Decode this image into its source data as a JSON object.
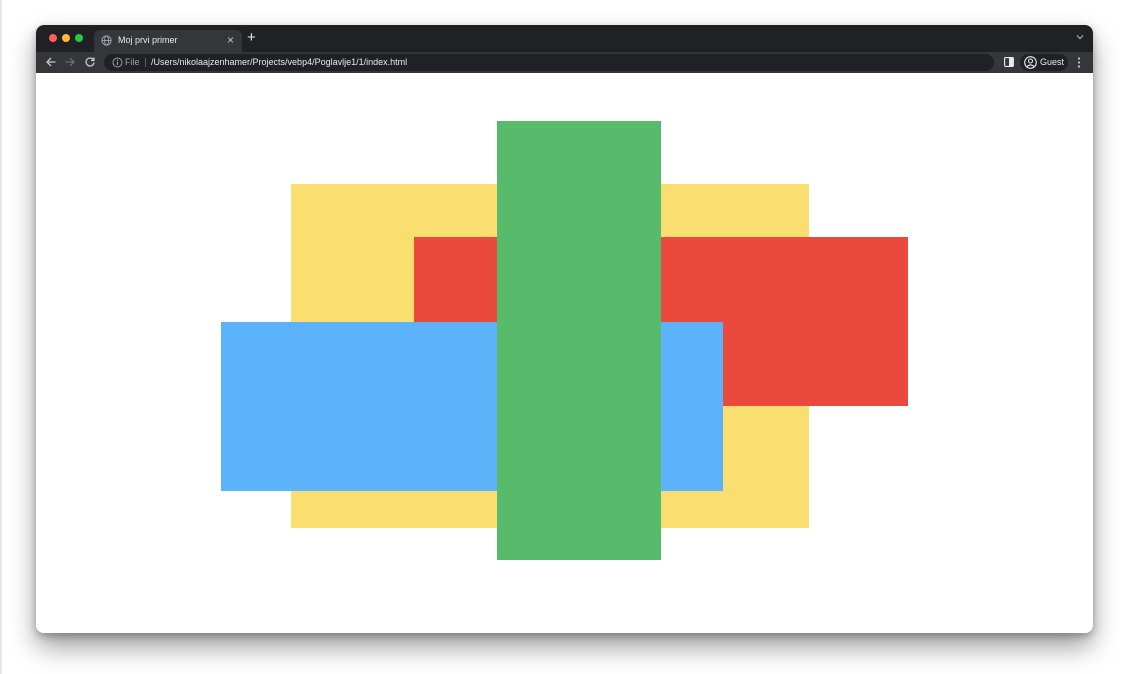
{
  "browser": {
    "window_controls": {
      "close_color": "#ff5f57",
      "minimize_color": "#febc2e",
      "maximize_color": "#28c840"
    },
    "tab": {
      "title": "Moj prvi primer",
      "favicon": "globe-icon",
      "close_glyph": "×"
    },
    "new_tab_glyph": "+",
    "tab_search_icon": "chevron-down-icon",
    "toolbar": {
      "back_icon": "back-arrow-icon",
      "forward_icon": "forward-arrow-icon",
      "reload_icon": "reload-icon",
      "info_icon": "info-icon",
      "scheme_label": "File",
      "url": "/Users/nikolaajzenhamer/Projects/vebp4/Poglavlje1/1/index.html",
      "side_panel_icon": "side-panel-icon",
      "profile_icon": "profile-icon",
      "profile_label": "Guest",
      "menu_icon": "kebab-menu-icon"
    }
  },
  "page": {
    "background": "#ffffff",
    "boxes": [
      {
        "name": "yellow-box",
        "color": "#fade6f"
      },
      {
        "name": "red-box",
        "color": "#ea4a3d"
      },
      {
        "name": "blue-box",
        "color": "#5db3fa"
      },
      {
        "name": "green-box",
        "color": "#57bb6b"
      }
    ]
  }
}
